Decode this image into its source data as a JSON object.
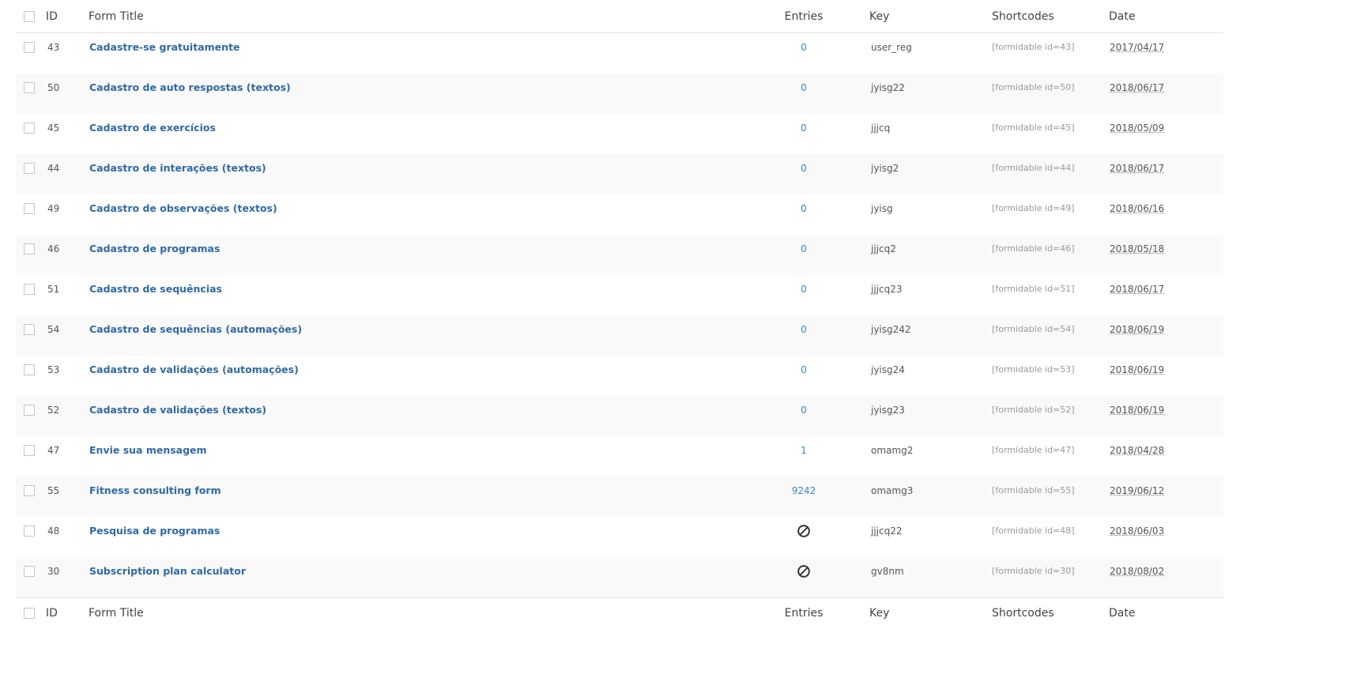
{
  "columns": {
    "id": "ID",
    "title": "Form Title",
    "entries": "Entries",
    "key": "Key",
    "shortcodes": "Shortcodes",
    "date": "Date"
  },
  "rows": [
    {
      "id": "43",
      "title": "Cadastre-se gratuitamente",
      "entries": "0",
      "key": "user_reg",
      "shortcode": "[formidable id=43]",
      "date": "2017/04/17"
    },
    {
      "id": "50",
      "title": "Cadastro de auto respostas (textos)",
      "entries": "0",
      "key": "jyisg22",
      "shortcode": "[formidable id=50]",
      "date": "2018/06/17"
    },
    {
      "id": "45",
      "title": "Cadastro de exercícios",
      "entries": "0",
      "key": "jjjcq",
      "shortcode": "[formidable id=45]",
      "date": "2018/05/09"
    },
    {
      "id": "44",
      "title": "Cadastro de interações (textos)",
      "entries": "0",
      "key": "jyisg2",
      "shortcode": "[formidable id=44]",
      "date": "2018/06/17"
    },
    {
      "id": "49",
      "title": "Cadastro de observações (textos)",
      "entries": "0",
      "key": "jyisg",
      "shortcode": "[formidable id=49]",
      "date": "2018/06/16"
    },
    {
      "id": "46",
      "title": "Cadastro de programas",
      "entries": "0",
      "key": "jjjcq2",
      "shortcode": "[formidable id=46]",
      "date": "2018/05/18"
    },
    {
      "id": "51",
      "title": "Cadastro de sequências",
      "entries": "0",
      "key": "jjjcq23",
      "shortcode": "[formidable id=51]",
      "date": "2018/06/17"
    },
    {
      "id": "54",
      "title": "Cadastro de sequências (automações)",
      "entries": "0",
      "key": "jyisg242",
      "shortcode": "[formidable id=54]",
      "date": "2018/06/19"
    },
    {
      "id": "53",
      "title": "Cadastro de validações (automações)",
      "entries": "0",
      "key": "jyisg24",
      "shortcode": "[formidable id=53]",
      "date": "2018/06/19"
    },
    {
      "id": "52",
      "title": "Cadastro de validações (textos)",
      "entries": "0",
      "key": "jyisg23",
      "shortcode": "[formidable id=52]",
      "date": "2018/06/19"
    },
    {
      "id": "47",
      "title": "Envie sua mensagem",
      "entries": "1",
      "key": "omamg2",
      "shortcode": "[formidable id=47]",
      "date": "2018/04/28"
    },
    {
      "id": "55",
      "title": "Fitness consulting form",
      "entries": "9242",
      "key": "omamg3",
      "shortcode": "[formidable id=55]",
      "date": "2019/06/12"
    },
    {
      "id": "48",
      "title": "Pesquisa de programas",
      "entries_icon": "no-entries-icon",
      "key": "jjjcq22",
      "shortcode": "[formidable id=48]",
      "date": "2018/06/03"
    },
    {
      "id": "30",
      "title": "Subscription plan calculator",
      "entries_icon": "no-entries-icon",
      "key": "gv8nm",
      "shortcode": "[formidable id=30]",
      "date": "2018/08/02"
    }
  ]
}
